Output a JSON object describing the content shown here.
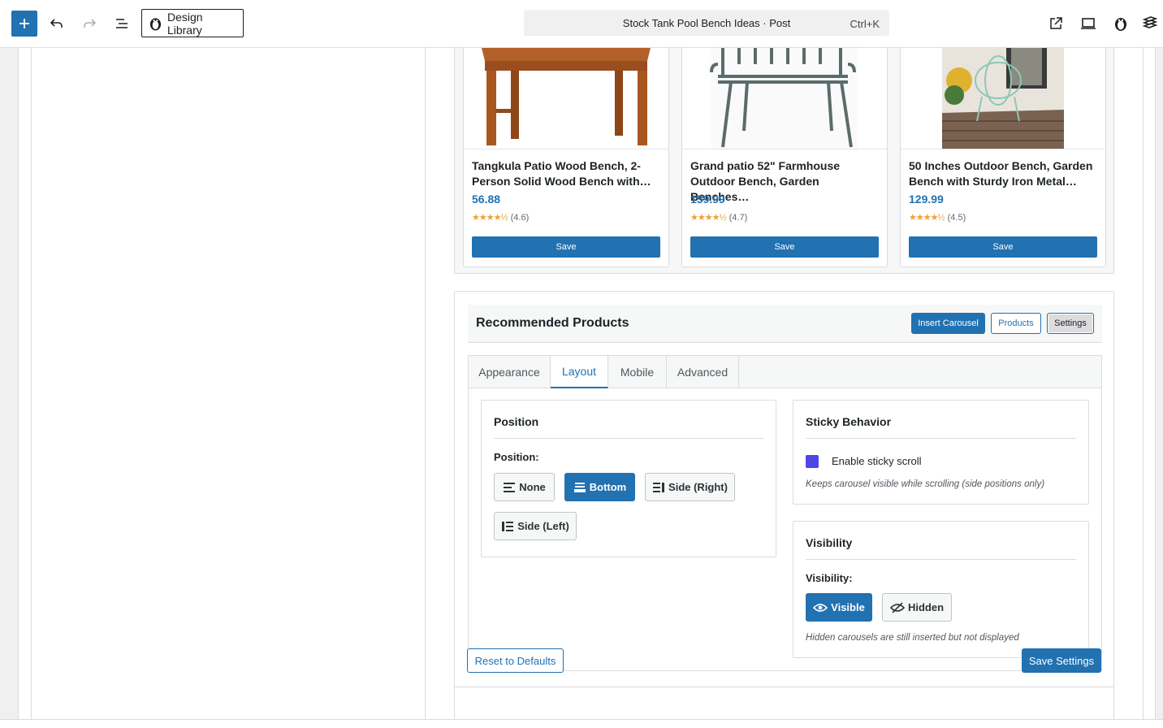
{
  "toolbar": {
    "design_library_label": "Design Library",
    "command": {
      "title": "Stock Tank Pool Bench Ideas · Post",
      "shortcut": "Ctrl+K"
    },
    "accent": "#2271b1"
  },
  "products": [
    {
      "name": "Tangkula Patio Wood Bench, 2-Person Solid Wood Bench with…",
      "price": "56.88",
      "stars": "★★★★½",
      "rating": "(4.6)",
      "save_label": "Save"
    },
    {
      "name": "Grand patio 52\" Farmhouse Outdoor Bench, Garden Benches…",
      "price": "159.99",
      "stars": "★★★★½",
      "rating": "(4.7)",
      "save_label": "Save"
    },
    {
      "name": "50 Inches Outdoor Bench, Garden Bench with Sturdy Iron Metal…",
      "price": "129.99",
      "stars": "★★★★½",
      "rating": "(4.5)",
      "save_label": "Save"
    }
  ],
  "panel": {
    "title": "Recommended Products",
    "buttons": {
      "insert": "Insert Carousel",
      "products": "Products",
      "settings": "Settings"
    },
    "tabs": [
      "Appearance",
      "Layout",
      "Mobile",
      "Advanced"
    ],
    "active_tab": "Layout",
    "position": {
      "title": "Position",
      "label": "Position:",
      "options": [
        "None",
        "Bottom",
        "Side (Right)",
        "Side (Left)"
      ],
      "selected": "Bottom"
    },
    "sticky": {
      "title": "Sticky Behavior",
      "checkbox_label": "Enable sticky scroll",
      "checked": true,
      "hint": "Keeps carousel visible while scrolling (side positions only)"
    },
    "visibility": {
      "title": "Visibility",
      "label": "Visibility:",
      "options": [
        "Visible",
        "Hidden"
      ],
      "selected": "Visible",
      "hint": "Hidden carousels are still inserted but not displayed"
    },
    "footer": {
      "reset": "Reset to Defaults",
      "save": "Save Settings"
    }
  }
}
